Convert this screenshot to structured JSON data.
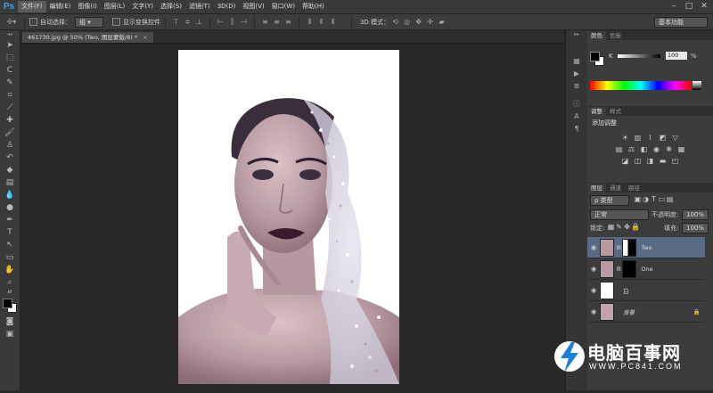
{
  "app": {
    "logo": "Ps"
  },
  "menu": [
    "文件(F)",
    "编辑(E)",
    "图像(I)",
    "图层(L)",
    "文字(Y)",
    "选择(S)",
    "滤镜(T)",
    "3D(D)",
    "视图(V)",
    "窗口(W)",
    "帮助(H)"
  ],
  "options": {
    "auto_select_label": "自动选择：",
    "auto_select_value": "组",
    "transform_label": "显示变换控件",
    "mode_3d_label": "3D 模式：",
    "workspace": "基本功能"
  },
  "document": {
    "tab_title": "461730.jpg @ 50% (Two, 图层蒙版/8) *"
  },
  "color_panel": {
    "tabs": [
      "颜色",
      "色板"
    ],
    "channel": "K",
    "value": "100",
    "unit": "%"
  },
  "adjust_panel": {
    "tabs": [
      "调整",
      "样式"
    ],
    "title": "添加调整"
  },
  "layers_panel": {
    "tabs": [
      "图层",
      "通道",
      "路径"
    ],
    "filter": "ρ 类型",
    "blend_mode": "正常",
    "opacity_label": "不透明度:",
    "opacity_value": "100%",
    "lock_label": "锁定:",
    "fill_label": "填充:",
    "fill_value": "100%",
    "layers": [
      {
        "name": "Two"
      },
      {
        "name": "One"
      },
      {
        "name": "白"
      },
      {
        "name": "背景"
      }
    ]
  },
  "watermark": {
    "brand": "电脑百事网",
    "url": "WWW.PC841.COM"
  },
  "colors": {
    "selected_layer": "#596a85",
    "ps_blue": "#2ea7f5",
    "watermark_blue": "#1e7fd6"
  }
}
